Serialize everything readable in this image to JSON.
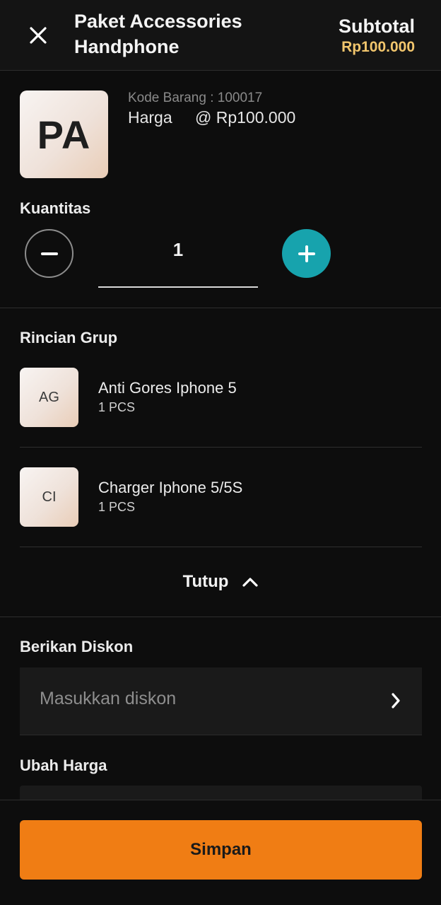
{
  "header": {
    "title": "Paket Accessories Handphone",
    "subtotal_label": "Subtotal",
    "subtotal_value": "Rp100.000"
  },
  "product": {
    "initials": "PA",
    "code_line": "Kode Barang : 100017",
    "price_label": "Harga",
    "price_value": "@ Rp100.000"
  },
  "quantity": {
    "label": "Kuantitas",
    "value": "1"
  },
  "group": {
    "title": "Rincian Grup",
    "items": [
      {
        "initials": "AG",
        "name": "Anti Gores Iphone 5",
        "qty": "1 PCS"
      },
      {
        "initials": "CI",
        "name": "Charger Iphone 5/5S",
        "qty": "1 PCS"
      }
    ],
    "collapse_label": "Tutup"
  },
  "discount": {
    "label": "Berikan Diskon",
    "placeholder": "Masukkan diskon"
  },
  "change_price": {
    "label": "Ubah Harga"
  },
  "footer": {
    "save_label": "Simpan"
  },
  "colors": {
    "accent": "#f07d14",
    "plus_button": "#17a3ad",
    "subtotal_value": "#f2c66d",
    "background": "#0d0d0d"
  },
  "icons": [
    "close-icon",
    "minus-icon",
    "plus-icon",
    "chevron-up-icon",
    "chevron-right-icon"
  ]
}
